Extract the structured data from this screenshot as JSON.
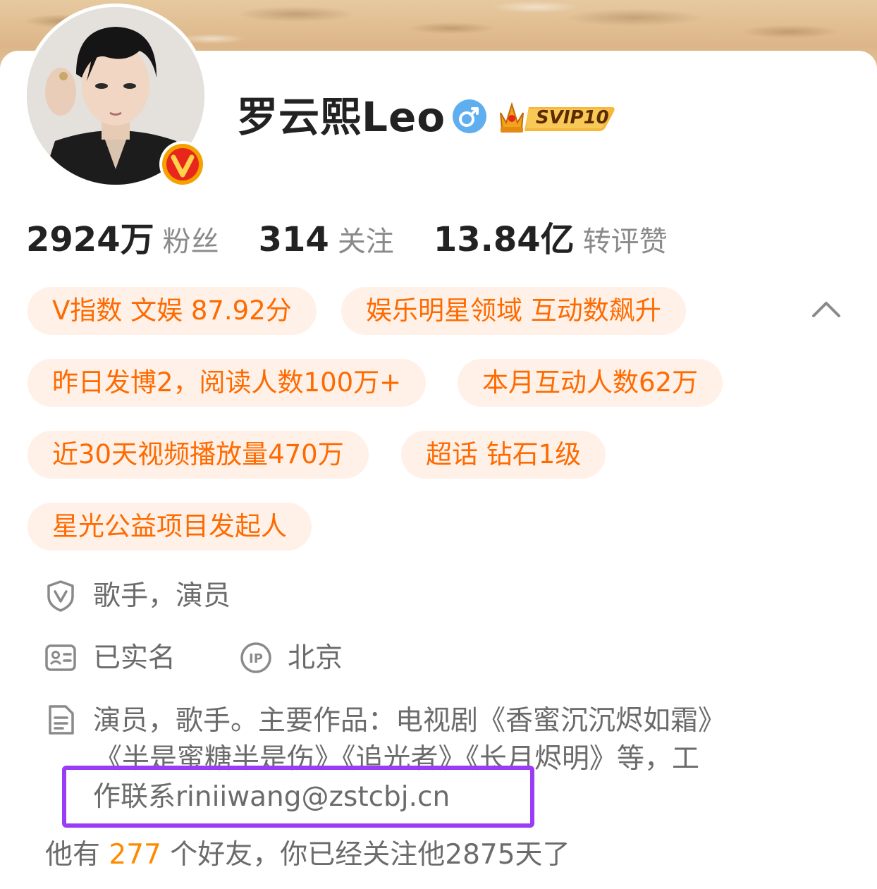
{
  "profile": {
    "name": "罗云熙Leo",
    "vip_label": "SVIP10",
    "gender_icon": "male-icon",
    "verified_icon": "verified-v-icon"
  },
  "stats": [
    {
      "value": "2924万",
      "label": "粉丝"
    },
    {
      "value": "314",
      "label": "关注"
    },
    {
      "value": "13.84亿",
      "label": "转评赞"
    }
  ],
  "tags": [
    "V指数 文娱 87.92分",
    "娱乐明星领域 互动数飙升",
    "昨日发博2，阅读人数100万+",
    "本月互动人数62万",
    "近30天视频播放量470万",
    "超话 钻石1级",
    "星光公益项目发起人"
  ],
  "info": {
    "certification": "歌手，演员",
    "real_name": "已实名",
    "ip_location": "北京",
    "bio_line1": "演员，歌手。主要作品：电视剧《香蜜沉沉烬如霜》",
    "bio_line2": "《半是蜜糖半是伤》《追光者》《长月烬明》等，工",
    "bio_line3": "作联系riniiwang@zstcbj.cn"
  },
  "friends": {
    "prefix": "他有",
    "count": "277",
    "suffix": "个好友，你已经关注他2875天了"
  },
  "colors": {
    "accent_orange": "#ff6a00",
    "tag_bg": "#fff1e8",
    "highlight_border": "#9a3cf5",
    "verified_orange": "#f5a200"
  }
}
